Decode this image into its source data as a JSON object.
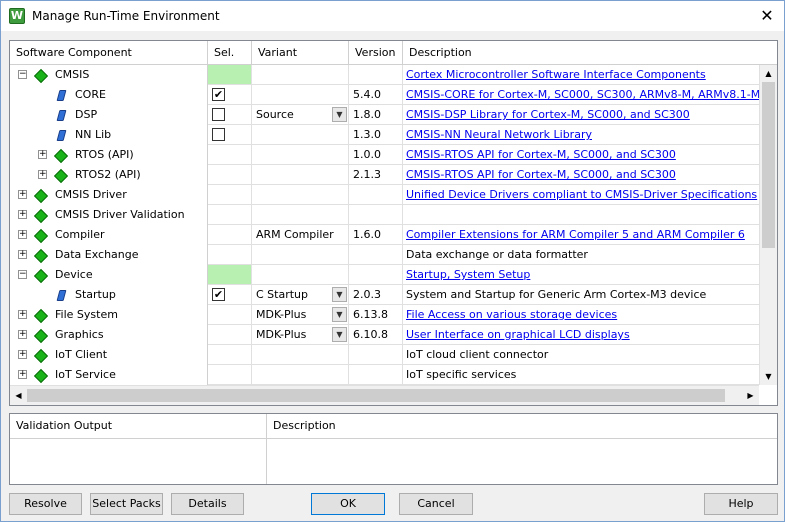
{
  "window": {
    "title": "Manage Run-Time Environment",
    "app_icon_glyph": "W",
    "close_glyph": "✕"
  },
  "grid": {
    "columns": [
      "Software Component",
      "Sel.",
      "Variant",
      "Version",
      "Description"
    ],
    "rows": [
      {
        "name": "CMSIS",
        "level": 0,
        "expander": "−",
        "icon": "green-diamond-icon",
        "sel": "green",
        "variant": "",
        "dropdown": false,
        "version": "",
        "desc": "Cortex Microcontroller Software Interface Components",
        "link": true
      },
      {
        "name": "CORE",
        "level": 1,
        "expander": "",
        "icon": "blue-gem-icon",
        "sel": "checked",
        "variant": "",
        "dropdown": false,
        "version": "5.4.0",
        "desc": "CMSIS-CORE for Cortex-M, SC000, SC300, ARMv8-M, ARMv8.1-M",
        "link": true
      },
      {
        "name": "DSP",
        "level": 1,
        "expander": "",
        "icon": "blue-gem-icon",
        "sel": "unchecked",
        "variant": "Source",
        "dropdown": true,
        "version": "1.8.0",
        "desc": "CMSIS-DSP Library for Cortex-M, SC000, and SC300",
        "link": true
      },
      {
        "name": "NN Lib",
        "level": 1,
        "expander": "",
        "icon": "blue-gem-icon",
        "sel": "unchecked",
        "variant": "",
        "dropdown": false,
        "version": "1.3.0",
        "desc": "CMSIS-NN Neural Network Library",
        "link": true
      },
      {
        "name": "RTOS (API)",
        "level": 1,
        "expander": "+",
        "icon": "green-diamond-icon",
        "sel": "",
        "variant": "",
        "dropdown": false,
        "version": "1.0.0",
        "desc": "CMSIS-RTOS API for Cortex-M, SC000, and SC300",
        "link": true
      },
      {
        "name": "RTOS2 (API)",
        "level": 1,
        "expander": "+",
        "icon": "green-diamond-icon",
        "sel": "",
        "variant": "",
        "dropdown": false,
        "version": "2.1.3",
        "desc": "CMSIS-RTOS API for Cortex-M, SC000, and SC300",
        "link": true
      },
      {
        "name": "CMSIS Driver",
        "level": 0,
        "expander": "+",
        "icon": "green-diamond-icon",
        "sel": "",
        "variant": "",
        "dropdown": false,
        "version": "",
        "desc": "Unified Device Drivers compliant to CMSIS-Driver Specifications",
        "link": true
      },
      {
        "name": "CMSIS Driver Validation",
        "level": 0,
        "expander": "+",
        "icon": "green-diamond-icon",
        "sel": "",
        "variant": "",
        "dropdown": false,
        "version": "",
        "desc": "",
        "link": false
      },
      {
        "name": "Compiler",
        "level": 0,
        "expander": "+",
        "icon": "green-diamond-icon",
        "sel": "",
        "variant": "ARM Compiler",
        "dropdown": false,
        "version": "1.6.0",
        "desc": "Compiler Extensions for ARM Compiler 5 and ARM Compiler 6",
        "link": true
      },
      {
        "name": "Data Exchange",
        "level": 0,
        "expander": "+",
        "icon": "green-diamond-icon",
        "sel": "",
        "variant": "",
        "dropdown": false,
        "version": "",
        "desc": "Data exchange or data formatter",
        "link": false
      },
      {
        "name": "Device",
        "level": 0,
        "expander": "−",
        "icon": "green-diamond-icon",
        "sel": "green",
        "variant": "",
        "dropdown": false,
        "version": "",
        "desc": "Startup, System Setup",
        "link": true
      },
      {
        "name": "Startup",
        "level": 1,
        "expander": "",
        "icon": "blue-gem-icon",
        "sel": "checked",
        "variant": "C Startup",
        "dropdown": true,
        "version": "2.0.3",
        "desc": "System and Startup for Generic Arm Cortex-M3 device",
        "link": false
      },
      {
        "name": "File System",
        "level": 0,
        "expander": "+",
        "icon": "green-diamond-icon",
        "sel": "",
        "variant": "MDK-Plus",
        "dropdown": true,
        "version": "6.13.8",
        "desc": "File Access on various storage devices",
        "link": true
      },
      {
        "name": "Graphics",
        "level": 0,
        "expander": "+",
        "icon": "green-diamond-icon",
        "sel": "",
        "variant": "MDK-Plus",
        "dropdown": true,
        "version": "6.10.8",
        "desc": "User Interface on graphical LCD displays",
        "link": true
      },
      {
        "name": "IoT Client",
        "level": 0,
        "expander": "+",
        "icon": "green-diamond-icon",
        "sel": "",
        "variant": "",
        "dropdown": false,
        "version": "",
        "desc": "IoT cloud client connector",
        "link": false
      },
      {
        "name": "IoT Service",
        "level": 0,
        "expander": "+",
        "icon": "green-diamond-icon",
        "sel": "",
        "variant": "",
        "dropdown": false,
        "version": "",
        "desc": "IoT specific services",
        "link": false
      }
    ]
  },
  "validation": {
    "col_output": "Validation Output",
    "col_description": "Description"
  },
  "buttons": {
    "resolve": "Resolve",
    "select_packs": "Select Packs",
    "details": "Details",
    "ok": "OK",
    "cancel": "Cancel",
    "help": "Help"
  },
  "colors": {
    "selection_green": "#b7f0b0",
    "link_blue": "#0000ee",
    "default_button_border": "#0078d7"
  }
}
